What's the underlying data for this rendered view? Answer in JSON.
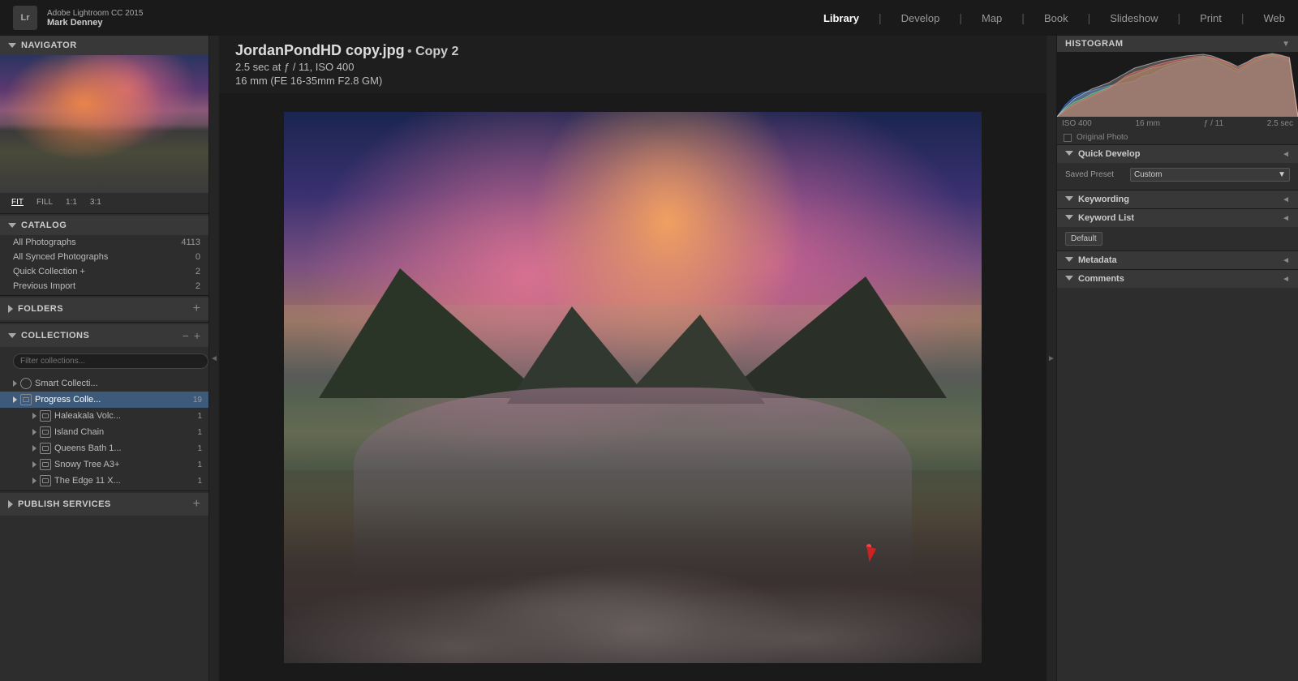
{
  "app": {
    "name": "Adobe Lightroom CC 2015",
    "user": "Mark Denney",
    "logo": "Lr"
  },
  "topnav": {
    "items": [
      {
        "label": "Library",
        "active": true
      },
      {
        "label": "Develop",
        "active": false
      },
      {
        "label": "Map",
        "active": false
      },
      {
        "label": "Book",
        "active": false
      },
      {
        "label": "Slideshow",
        "active": false
      },
      {
        "label": "Print",
        "active": false
      },
      {
        "label": "Web",
        "active": false
      }
    ]
  },
  "navigator": {
    "title": "Navigator",
    "zoom_levels": [
      "FIT",
      "FILL",
      "1:1",
      "3:1"
    ]
  },
  "catalog": {
    "title": "Catalog",
    "items": [
      {
        "label": "All Photographs",
        "count": "4113"
      },
      {
        "label": "All Synced Photographs",
        "count": "0"
      },
      {
        "label": "Quick Collection +",
        "count": "2"
      },
      {
        "label": "Previous Import",
        "count": "2"
      }
    ]
  },
  "folders": {
    "title": "Folders"
  },
  "collections": {
    "title": "Collections",
    "search_placeholder": "Filter collections...",
    "groups": [
      {
        "name": "Smart Collecti...",
        "type": "smart",
        "count": "",
        "expanded": false
      },
      {
        "name": "Progress Colle...",
        "type": "folder",
        "count": "19",
        "expanded": true,
        "active": true,
        "children": [
          {
            "name": "Haleakala Volc...",
            "type": "collection",
            "count": "1"
          },
          {
            "name": "Island Chain",
            "type": "collection",
            "count": "1"
          },
          {
            "name": "Queens Bath 1...",
            "type": "collection",
            "count": "1"
          },
          {
            "name": "Snowy Tree A3+",
            "type": "collection",
            "count": "1"
          },
          {
            "name": "The Edge 11 X...",
            "type": "collection",
            "count": "1"
          }
        ]
      }
    ]
  },
  "publish_services": {
    "title": "Publish Services"
  },
  "photo": {
    "filename": "JordanPondHD copy.jpg",
    "copy_label": "Copy 2",
    "exposure": "2.5 sec at ƒ / 11, ISO 400",
    "lens": "16 mm (FE 16-35mm F2.8 GM)"
  },
  "histogram": {
    "title": "Histogram",
    "iso": "ISO 400",
    "focal_length": "16 mm",
    "aperture": "ƒ / 11",
    "shutter": "2.5 sec",
    "original_photo_label": "Original Photo"
  },
  "quick_develop": {
    "title": "Quick Develop",
    "preset_label": "Custom",
    "collapse_icon": "◄"
  },
  "keywording": {
    "title": "Keywording",
    "collapse_icon": "◄"
  },
  "keyword_list": {
    "title": "Keyword List",
    "collapse_icon": "◄",
    "preset": "Default"
  },
  "metadata": {
    "title": "Metadata",
    "collapse_icon": "◄"
  },
  "comments": {
    "title": "Comments",
    "collapse_icon": "◄"
  }
}
